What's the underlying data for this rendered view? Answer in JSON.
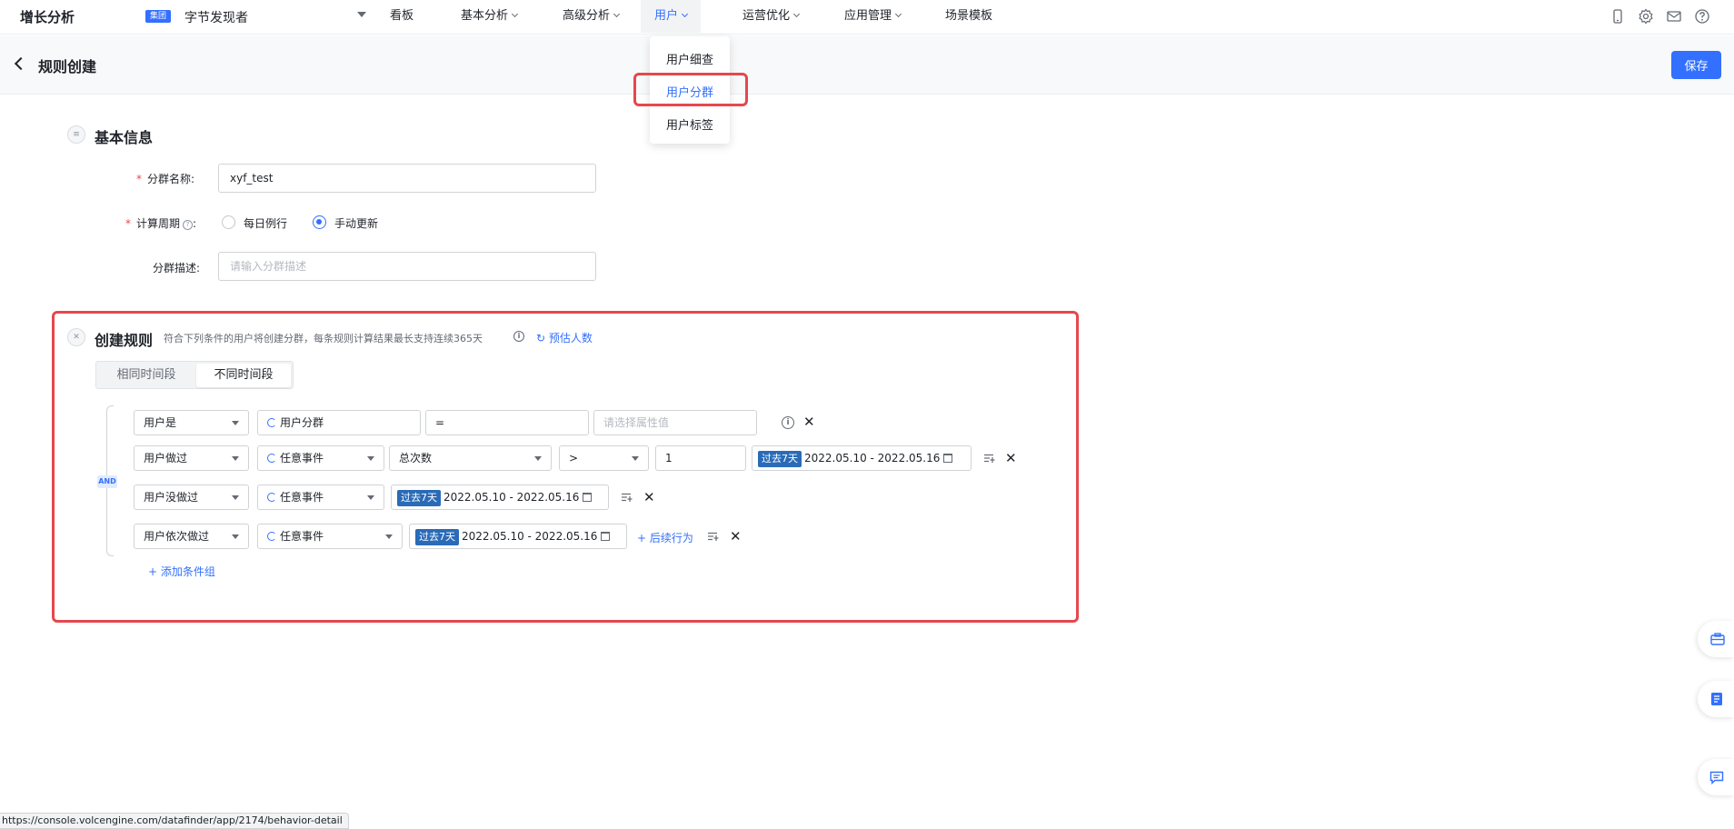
{
  "topnav": {
    "brand": "增长分析",
    "group_badge": "集团",
    "app_name": "字节发现者",
    "items": [
      {
        "label": "看板",
        "has_caret": false
      },
      {
        "label": "基本分析",
        "has_caret": true
      },
      {
        "label": "高级分析",
        "has_caret": true
      },
      {
        "label": "用户",
        "has_caret": true,
        "active": true
      },
      {
        "label": "运营优化",
        "has_caret": true
      },
      {
        "label": "应用管理",
        "has_caret": true
      },
      {
        "label": "场景模板",
        "has_caret": false
      }
    ],
    "icons": [
      "mobile-icon",
      "gear-icon",
      "mail-icon",
      "help-icon"
    ]
  },
  "dropdown": {
    "items": [
      "用户细查",
      "用户分群",
      "用户标签"
    ],
    "selected": "用户分群"
  },
  "header": {
    "title": "规则创建",
    "save_label": "保存"
  },
  "basic_info": {
    "title": "基本信息",
    "name_label": "分群名称:",
    "name_value": "xyf_test",
    "period_label": "计算周期",
    "period_colon": ":",
    "period_options": [
      "每日例行",
      "手动更新"
    ],
    "period_selected": "手动更新",
    "desc_label": "分群描述:",
    "desc_placeholder": "请输入分群描述"
  },
  "rules": {
    "title": "创建规则",
    "description": "符合下列条件的用户将创建分群，每条规则计算结果最长支持连续365天",
    "estimate_label": "预估人数",
    "segments": [
      "相同时间段",
      "不同时间段"
    ],
    "segment_selected": "不同时间段",
    "logic": "AND",
    "row1": {
      "type": "用户是",
      "prop": "用户分群",
      "op": "=",
      "value_placeholder": "请选择属性值"
    },
    "row2": {
      "type": "用户做过",
      "event": "任意事件",
      "metric": "总次数",
      "op": ">",
      "value": "1",
      "date_tag": "过去7天",
      "date_range": "2022.05.10 - 2022.05.16"
    },
    "row3": {
      "type": "用户没做过",
      "event": "任意事件",
      "date_tag": "过去7天",
      "date_range": "2022.05.10 - 2022.05.16"
    },
    "row4": {
      "type": "用户依次做过",
      "event": "任意事件",
      "date_tag": "过去7天",
      "date_range": "2022.05.10 - 2022.05.16",
      "followup_label": "后续行为"
    },
    "add_group_label": "添加条件组"
  },
  "status_url": "https://console.volcengine.com/datafinder/app/2174/behavior-detail",
  "colors": {
    "accent": "#3370ff",
    "highlight_border": "#e5484d",
    "date_tag": "#2a6bb8"
  }
}
